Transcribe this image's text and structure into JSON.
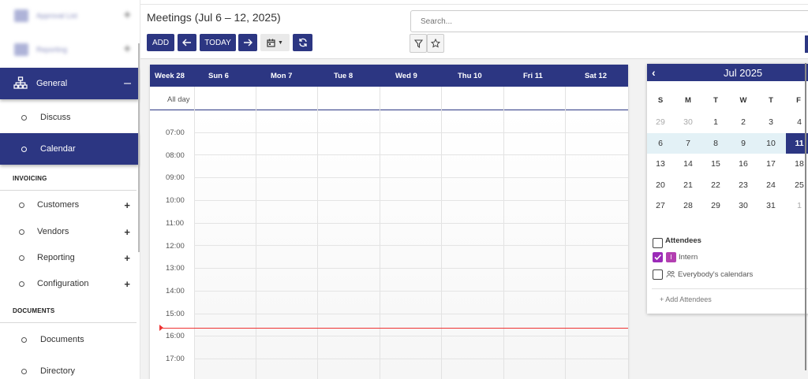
{
  "sidebar": {
    "blurred_items": [
      {
        "label": "Approval List"
      },
      {
        "label": "Reporting"
      }
    ],
    "general": {
      "label": "General"
    },
    "general_sub": [
      {
        "label": "Discuss"
      },
      {
        "label": "Calendar"
      }
    ],
    "invoicing": {
      "title": "INVOICING",
      "items": [
        {
          "label": "Customers"
        },
        {
          "label": "Vendors"
        },
        {
          "label": "Reporting"
        },
        {
          "label": "Configuration"
        }
      ]
    },
    "documents": {
      "title": "DOCUMENTS",
      "items": [
        {
          "label": "Documents"
        },
        {
          "label": "Directory"
        }
      ]
    }
  },
  "header": {
    "title": "Meetings (Jul 6 – 12, 2025)",
    "search_placeholder": "Search..."
  },
  "toolbar": {
    "add_label": "ADD",
    "today_label": "TODAY"
  },
  "calendar": {
    "week_label": "Week 28",
    "days": [
      "Sun 6",
      "Mon 7",
      "Tue 8",
      "Wed 9",
      "Thu 10",
      "Fri 11",
      "Sat 12"
    ],
    "allday_label": "All day",
    "hours": [
      "07:00",
      "08:00",
      "09:00",
      "10:00",
      "11:00",
      "12:00",
      "13:00",
      "14:00",
      "15:00",
      "16:00",
      "17:00"
    ]
  },
  "mini_calendar": {
    "title": "Jul 2025",
    "dow": [
      "S",
      "M",
      "T",
      "W",
      "T",
      "F"
    ],
    "weeks": [
      [
        "29",
        "30",
        "1",
        "2",
        "3",
        "4"
      ],
      [
        "6",
        "7",
        "8",
        "9",
        "10",
        "11"
      ],
      [
        "13",
        "14",
        "15",
        "16",
        "17",
        "18"
      ],
      [
        "20",
        "21",
        "22",
        "23",
        "24",
        "25"
      ],
      [
        "27",
        "28",
        "29",
        "30",
        "31",
        "1"
      ]
    ],
    "today": "11"
  },
  "attendees": {
    "title": "Attendees",
    "items": [
      {
        "label": "Intern",
        "badge": "I",
        "checked": true
      },
      {
        "label": "Everybody's calendars",
        "checked": false
      }
    ],
    "add_label": "+ Add Attendees"
  },
  "colors": {
    "primary": "#2c3682",
    "now_line": "#e33333",
    "attendee_checked": "#9b2ab8"
  }
}
